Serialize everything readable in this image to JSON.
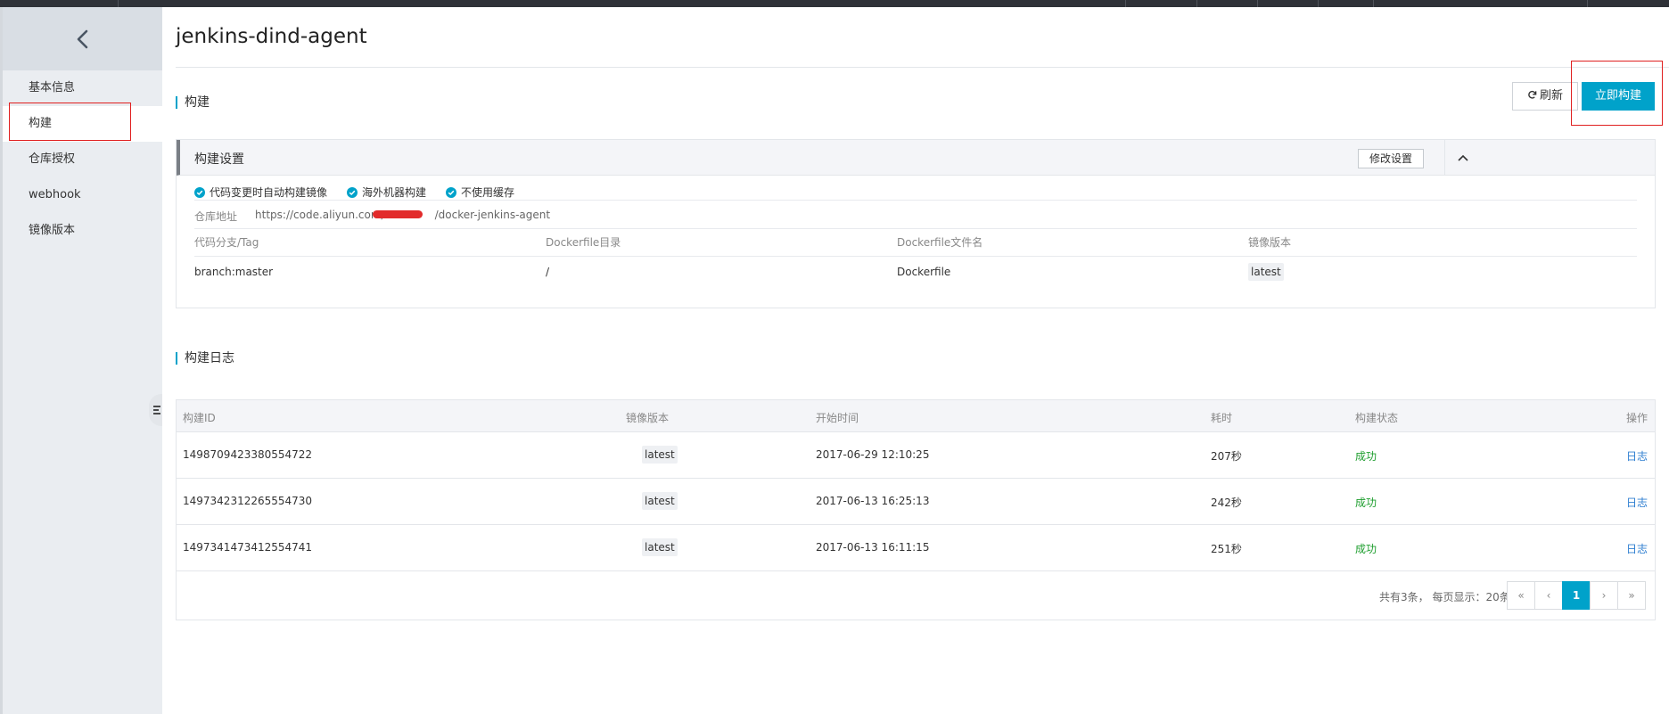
{
  "colors": {
    "accent": "#00a2ca",
    "success": "#1e9e2e",
    "link": "#2f7fd1",
    "highlight": "#e02020"
  },
  "sidebar": {
    "back_icon": "chevron-left-icon",
    "items": [
      {
        "label": "基本信息"
      },
      {
        "label": "构建"
      },
      {
        "label": "仓库授权"
      },
      {
        "label": "webhook"
      },
      {
        "label": "镜像版本"
      }
    ]
  },
  "header": {
    "title": "jenkins-dind-agent"
  },
  "build": {
    "section_title": "构建",
    "refresh_label": "刷新",
    "refresh_icon": "refresh-icon",
    "build_now_label": "立即构建"
  },
  "settings": {
    "title": "构建设置",
    "edit_label": "修改设置",
    "collapse_icon": "chevron-up-icon",
    "checks": [
      {
        "label": "代码变更时自动构建镜像"
      },
      {
        "label": "海外机器构建"
      },
      {
        "label": "不使用缓存"
      }
    ],
    "repo_label": "仓库地址",
    "repo_url_prefix": "https://code.aliyun.com/",
    "repo_url_suffix": "/docker-jenkins-agent",
    "columns": [
      "代码分支/Tag",
      "Dockerfile目录",
      "Dockerfile文件名",
      "镜像版本"
    ],
    "values": [
      "branch:master",
      "/",
      "Dockerfile",
      "latest"
    ]
  },
  "logs": {
    "section_title": "构建日志",
    "columns": [
      "构建ID",
      "镜像版本",
      "开始时间",
      "耗时",
      "构建状态",
      "操作"
    ],
    "rows": [
      {
        "id": "1498709423380554722",
        "version": "latest",
        "start": "2017-06-29 12:10:25",
        "duration": "207秒",
        "status": "成功",
        "action": "日志"
      },
      {
        "id": "1497342312265554730",
        "version": "latest",
        "start": "2017-06-13 16:25:13",
        "duration": "242秒",
        "status": "成功",
        "action": "日志"
      },
      {
        "id": "1497341473412554741",
        "version": "latest",
        "start": "2017-06-13 16:11:15",
        "duration": "251秒",
        "status": "成功",
        "action": "日志"
      }
    ],
    "pager_info": "共有3条， 每页显示：20条",
    "pager": {
      "first": "«",
      "prev": "‹",
      "current": "1",
      "next": "›",
      "last": "»"
    }
  }
}
